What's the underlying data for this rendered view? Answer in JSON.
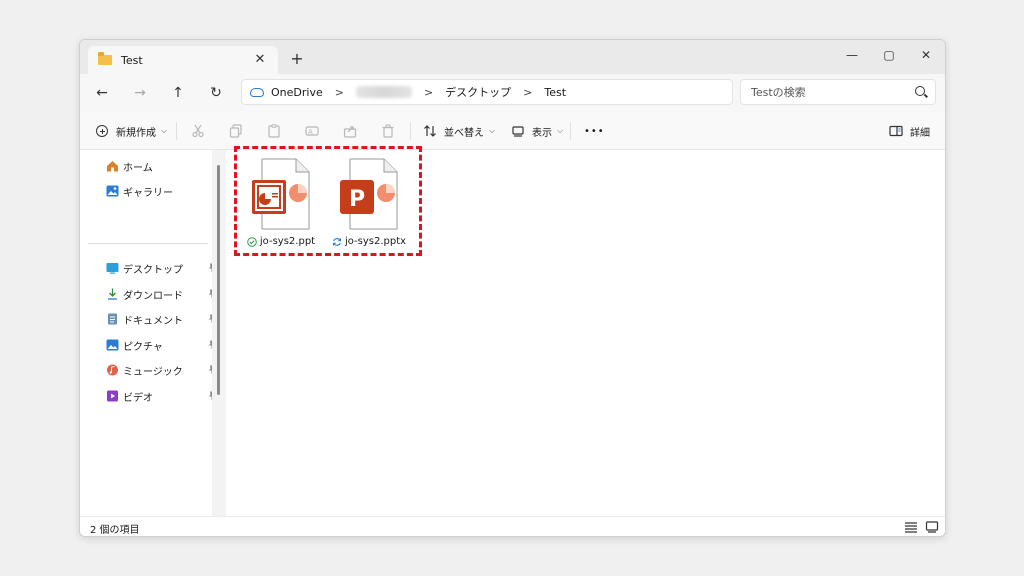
{
  "tab": {
    "title": "Test",
    "close": "✕"
  },
  "newtab": "+",
  "window_controls": {
    "minimize": "—",
    "maximize": "▢",
    "close": "✕"
  },
  "nav": {
    "back": "←",
    "forward": "→",
    "up": "↑",
    "refresh": "↻"
  },
  "breadcrumb": {
    "items": [
      "OneDrive",
      "デスクトップ",
      "Test"
    ],
    "separator": ">"
  },
  "search": {
    "placeholder": "Testの検索"
  },
  "toolbar": {
    "new_label": "新規作成",
    "sort_label": "並べ替え",
    "view_label": "表示",
    "more": "•••",
    "details_label": "詳細",
    "chevron": "⌵"
  },
  "sidebar": {
    "items": [
      {
        "label": "ホーム",
        "icon": "home-icon",
        "color": "#d9822b"
      },
      {
        "label": "ギャラリー",
        "icon": "gallery-icon",
        "color": "#2b7cd3"
      },
      {
        "label": "デスクトップ",
        "icon": "desktop-icon",
        "color": "#2b9fd8"
      },
      {
        "label": "ダウンロード",
        "icon": "download-icon",
        "color": "#2b8a3e"
      },
      {
        "label": "ドキュメント",
        "icon": "document-icon",
        "color": "#6b8fb5"
      },
      {
        "label": "ピクチャ",
        "icon": "pictures-icon",
        "color": "#2b7cd3"
      },
      {
        "label": "ミュージック",
        "icon": "music-icon",
        "color": "#e0604a"
      },
      {
        "label": "ビデオ",
        "icon": "video-icon",
        "color": "#8a3fc4"
      }
    ],
    "pin": "📌"
  },
  "files": [
    {
      "name": "jo-sys2.ppt",
      "status": "synced",
      "icon": "powerpoint-legacy-icon"
    },
    {
      "name": "jo-sys2.pptx",
      "status": "syncing",
      "icon": "powerpoint-icon"
    }
  ],
  "colors": {
    "accent": "#c43e1c",
    "highlight": "#e0141e",
    "pie": "#f28d6d"
  },
  "statusbar": {
    "count": "2 個の項目"
  }
}
